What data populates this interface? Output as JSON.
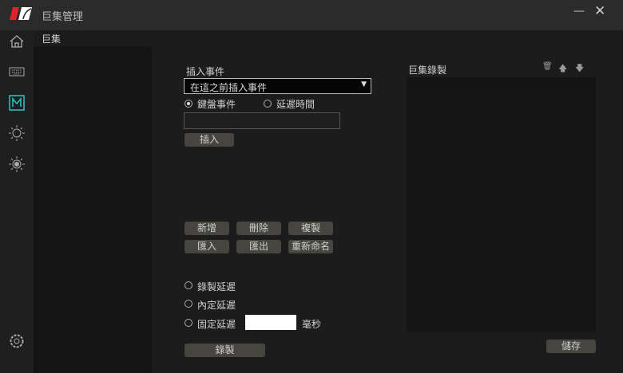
{
  "window": {
    "title": "巨集管理"
  },
  "macro_list": {
    "header": "巨集"
  },
  "insert": {
    "label": "插入事件",
    "dropdown_value": "在這之前插入事件",
    "radio_keyboard": "鍵盤事件",
    "radio_delay": "延遲時間",
    "input_value": "",
    "insert_button": "插入"
  },
  "actions": {
    "new": "新增",
    "delete": "刪除",
    "copy": "複製",
    "import": "匯入",
    "export": "匯出",
    "rename": "重新命名"
  },
  "delay": {
    "record_delay": "錄製延遲",
    "default_delay": "內定延遲",
    "fixed_delay": "固定延遲",
    "fixed_value": "",
    "unit": "毫秒"
  },
  "record_button": "錄製",
  "recording": {
    "header": "巨集錄製",
    "save_button": "儲存"
  },
  "colors": {
    "accent": "#2ec4c4",
    "logo_red": "#e0202a"
  }
}
